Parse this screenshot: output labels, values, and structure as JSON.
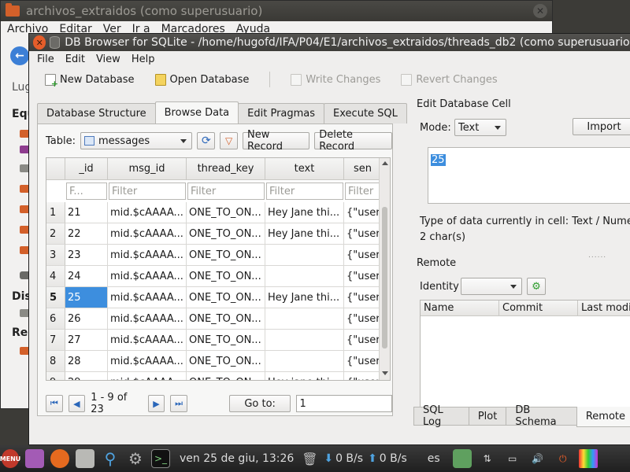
{
  "bg_window": {
    "title": "archivos_extraidos (como superusuario)",
    "menu": [
      "Archivo",
      "Editar",
      "Ver",
      "Ir a",
      "Marcadores",
      "Ayuda"
    ],
    "sidebar": {
      "places_label": "Lug",
      "section1": "Equ",
      "section2": "Dis",
      "section3": "Red"
    }
  },
  "db_window": {
    "title": "DB Browser for SQLite - /home/hugofd/IFA/P04/E1/archivos_extraidos/threads_db2 (como superusuario)",
    "menu": [
      "File",
      "Edit",
      "View",
      "Help"
    ],
    "toolbar": {
      "new_db": "New Database",
      "open_db": "Open Database",
      "write_changes": "Write Changes",
      "revert_changes": "Revert Changes"
    },
    "tabs": [
      "Database Structure",
      "Browse Data",
      "Edit Pragmas",
      "Execute SQL"
    ],
    "active_tab": "Browse Data",
    "browse": {
      "table_label": "Table:",
      "table_value": "messages",
      "new_record": "New Record",
      "delete_record": "Delete Record",
      "columns": [
        "_id",
        "msg_id",
        "thread_key",
        "text",
        "sen"
      ],
      "filters": [
        "F...",
        "Filter",
        "Filter",
        "Filter",
        "Filter"
      ],
      "rows": [
        {
          "n": "1",
          "id": "21",
          "msg_id": "mid.$cAAAA...",
          "thread_key": "ONE_TO_ON...",
          "text": "Hey Jane thi...",
          "sender": "{\"user_"
        },
        {
          "n": "2",
          "id": "22",
          "msg_id": "mid.$cAAAA...",
          "thread_key": "ONE_TO_ON...",
          "text": "Hey Jane thi...",
          "sender": "{\"user_"
        },
        {
          "n": "3",
          "id": "23",
          "msg_id": "mid.$cAAAA...",
          "thread_key": "ONE_TO_ON...",
          "text": "",
          "sender": "{\"user_"
        },
        {
          "n": "4",
          "id": "24",
          "msg_id": "mid.$cAAAA...",
          "thread_key": "ONE_TO_ON...",
          "text": "",
          "sender": "{\"user_"
        },
        {
          "n": "5",
          "id": "25",
          "msg_id": "mid.$cAAAA...",
          "thread_key": "ONE_TO_ON...",
          "text": "Hey Jane thi...",
          "sender": "{\"user_"
        },
        {
          "n": "6",
          "id": "26",
          "msg_id": "mid.$cAAAA...",
          "thread_key": "ONE_TO_ON...",
          "text": "",
          "sender": "{\"user_"
        },
        {
          "n": "7",
          "id": "27",
          "msg_id": "mid.$cAAAA...",
          "thread_key": "ONE_TO_ON...",
          "text": "",
          "sender": "{\"user_"
        },
        {
          "n": "8",
          "id": "28",
          "msg_id": "mid.$cAAAA...",
          "thread_key": "ONE_TO_ON...",
          "text": "",
          "sender": "{\"user_"
        },
        {
          "n": "9",
          "id": "29",
          "msg_id": "mid.$cAAAA...",
          "thread_key": "ONE_TO_ON...",
          "text": "Hey jane thi...",
          "sender": "{\"user_"
        }
      ],
      "selected_row": 5,
      "page_info": "1 - 9 of 23",
      "goto_label": "Go to:",
      "goto_value": "1"
    },
    "edit_cell": {
      "title": "Edit Database Cell",
      "mode_label": "Mode:",
      "mode_value": "Text",
      "import": "Import",
      "value": "25",
      "type_info": "Type of data currently in cell: Text / Numeric",
      "size_info": "2 char(s)"
    },
    "remote": {
      "title": "Remote",
      "identity_label": "Identity",
      "columns": [
        "Name",
        "Commit",
        "Last modified"
      ]
    },
    "bottom_tabs": [
      "SQL Log",
      "Plot",
      "DB Schema",
      "Remote"
    ],
    "active_bottom_tab": "Remote"
  },
  "taskbar": {
    "menu_label": "MENU",
    "clock": "ven 25 de giu, 13:26",
    "download": "0 B/s",
    "upload": "0 B/s",
    "lang": "es"
  },
  "colors": {
    "selection": "#3d8ede",
    "accent_orange": "#e55d2a"
  }
}
